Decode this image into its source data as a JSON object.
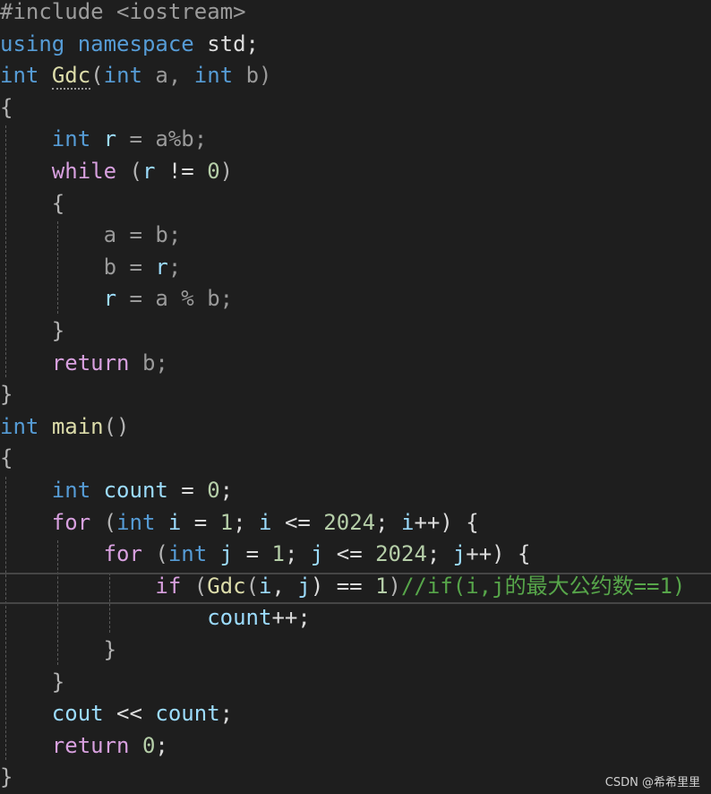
{
  "colors": {
    "background": "#1e1e1e",
    "keyword": "#569cd6",
    "control": "#d8a0df",
    "function": "#dcdcaa",
    "variable": "#9cdcfe",
    "param": "#9a9a9a",
    "number": "#b5cea8",
    "comment": "#57a64a",
    "punct": "#b4b4b4",
    "plain": "#dcdcdc",
    "preproc": "#9b9b9b"
  },
  "code_lines": [
    [
      {
        "t": "#include <iostream>",
        "c": "preproc"
      }
    ],
    [
      {
        "t": "using namespace",
        "c": "keyword"
      },
      {
        "t": " std;",
        "c": "plain"
      }
    ],
    [
      {
        "t": "int",
        "c": "keyword"
      },
      {
        "t": " ",
        "c": "plain"
      },
      {
        "t": "Gdc",
        "c": "function"
      },
      {
        "t": "(",
        "c": "punct"
      },
      {
        "t": "int",
        "c": "keyword"
      },
      {
        "t": " a, ",
        "c": "param"
      },
      {
        "t": "int",
        "c": "keyword"
      },
      {
        "t": " b)",
        "c": "param"
      }
    ],
    [
      {
        "t": "{",
        "c": "punct"
      }
    ],
    [
      {
        "t": "    ",
        "c": "plain"
      },
      {
        "t": "int",
        "c": "keyword"
      },
      {
        "t": " ",
        "c": "plain"
      },
      {
        "t": "r",
        "c": "variable"
      },
      {
        "t": " = a%b;",
        "c": "param"
      }
    ],
    [
      {
        "t": "    ",
        "c": "plain"
      },
      {
        "t": "while",
        "c": "control"
      },
      {
        "t": " (",
        "c": "punct"
      },
      {
        "t": "r",
        "c": "variable"
      },
      {
        "t": " != ",
        "c": "plain"
      },
      {
        "t": "0",
        "c": "number"
      },
      {
        "t": ")",
        "c": "punct"
      }
    ],
    [
      {
        "t": "    {",
        "c": "punct"
      }
    ],
    [
      {
        "t": "        a = b;",
        "c": "param"
      }
    ],
    [
      {
        "t": "        b = ",
        "c": "param"
      },
      {
        "t": "r",
        "c": "variable"
      },
      {
        "t": ";",
        "c": "param"
      }
    ],
    [
      {
        "t": "        ",
        "c": "plain"
      },
      {
        "t": "r",
        "c": "variable"
      },
      {
        "t": " = a % b;",
        "c": "param"
      }
    ],
    [
      {
        "t": "    }",
        "c": "punct"
      }
    ],
    [
      {
        "t": "    ",
        "c": "plain"
      },
      {
        "t": "return",
        "c": "control"
      },
      {
        "t": " b;",
        "c": "param"
      }
    ],
    [
      {
        "t": "}",
        "c": "punct"
      }
    ],
    [
      {
        "t": "int",
        "c": "keyword"
      },
      {
        "t": " ",
        "c": "plain"
      },
      {
        "t": "main",
        "c": "function"
      },
      {
        "t": "()",
        "c": "punct"
      }
    ],
    [
      {
        "t": "{",
        "c": "punct"
      }
    ],
    [
      {
        "t": "    ",
        "c": "plain"
      },
      {
        "t": "int",
        "c": "keyword"
      },
      {
        "t": " ",
        "c": "plain"
      },
      {
        "t": "count",
        "c": "variable"
      },
      {
        "t": " = ",
        "c": "plain"
      },
      {
        "t": "0",
        "c": "number"
      },
      {
        "t": ";",
        "c": "plain"
      }
    ],
    [
      {
        "t": "    ",
        "c": "plain"
      },
      {
        "t": "for",
        "c": "control"
      },
      {
        "t": " (",
        "c": "punct"
      },
      {
        "t": "int",
        "c": "keyword"
      },
      {
        "t": " ",
        "c": "plain"
      },
      {
        "t": "i",
        "c": "variable"
      },
      {
        "t": " = ",
        "c": "plain"
      },
      {
        "t": "1",
        "c": "number"
      },
      {
        "t": "; ",
        "c": "plain"
      },
      {
        "t": "i",
        "c": "variable"
      },
      {
        "t": " <= ",
        "c": "plain"
      },
      {
        "t": "2024",
        "c": "number"
      },
      {
        "t": "; ",
        "c": "plain"
      },
      {
        "t": "i",
        "c": "variable"
      },
      {
        "t": "++) {",
        "c": "plain"
      }
    ],
    [
      {
        "t": "        ",
        "c": "plain"
      },
      {
        "t": "for",
        "c": "control"
      },
      {
        "t": " (",
        "c": "punct"
      },
      {
        "t": "int",
        "c": "keyword"
      },
      {
        "t": " ",
        "c": "plain"
      },
      {
        "t": "j",
        "c": "variable"
      },
      {
        "t": " = ",
        "c": "plain"
      },
      {
        "t": "1",
        "c": "number"
      },
      {
        "t": "; ",
        "c": "plain"
      },
      {
        "t": "j",
        "c": "variable"
      },
      {
        "t": " <= ",
        "c": "plain"
      },
      {
        "t": "2024",
        "c": "number"
      },
      {
        "t": "; ",
        "c": "plain"
      },
      {
        "t": "j",
        "c": "variable"
      },
      {
        "t": "++) {",
        "c": "plain"
      }
    ],
    [
      {
        "t": "            ",
        "c": "plain"
      },
      {
        "t": "if",
        "c": "control"
      },
      {
        "t": " (",
        "c": "punct"
      },
      {
        "t": "Gdc",
        "c": "function"
      },
      {
        "t": "(",
        "c": "punct"
      },
      {
        "t": "i",
        "c": "variable"
      },
      {
        "t": ", ",
        "c": "plain"
      },
      {
        "t": "j",
        "c": "variable"
      },
      {
        "t": ") == ",
        "c": "plain"
      },
      {
        "t": "1",
        "c": "number"
      },
      {
        "t": ")",
        "c": "punct"
      },
      {
        "t": "//if(i,j的最大公约数==1)",
        "c": "comment"
      }
    ],
    [
      {
        "t": "                ",
        "c": "plain"
      },
      {
        "t": "count",
        "c": "variable"
      },
      {
        "t": "++;",
        "c": "plain"
      }
    ],
    [
      {
        "t": "        }",
        "c": "punct"
      }
    ],
    [
      {
        "t": "    }",
        "c": "punct"
      }
    ],
    [
      {
        "t": "    ",
        "c": "plain"
      },
      {
        "t": "cout",
        "c": "variable"
      },
      {
        "t": " << ",
        "c": "plain"
      },
      {
        "t": "count",
        "c": "variable"
      },
      {
        "t": ";",
        "c": "plain"
      }
    ],
    [
      {
        "t": "    ",
        "c": "plain"
      },
      {
        "t": "return",
        "c": "control"
      },
      {
        "t": " ",
        "c": "plain"
      },
      {
        "t": "0",
        "c": "number"
      },
      {
        "t": ";",
        "c": "plain"
      }
    ],
    [
      {
        "t": "}",
        "c": "punct"
      }
    ]
  ],
  "current_line_index": 18,
  "watermark": "CSDN @希希里里"
}
